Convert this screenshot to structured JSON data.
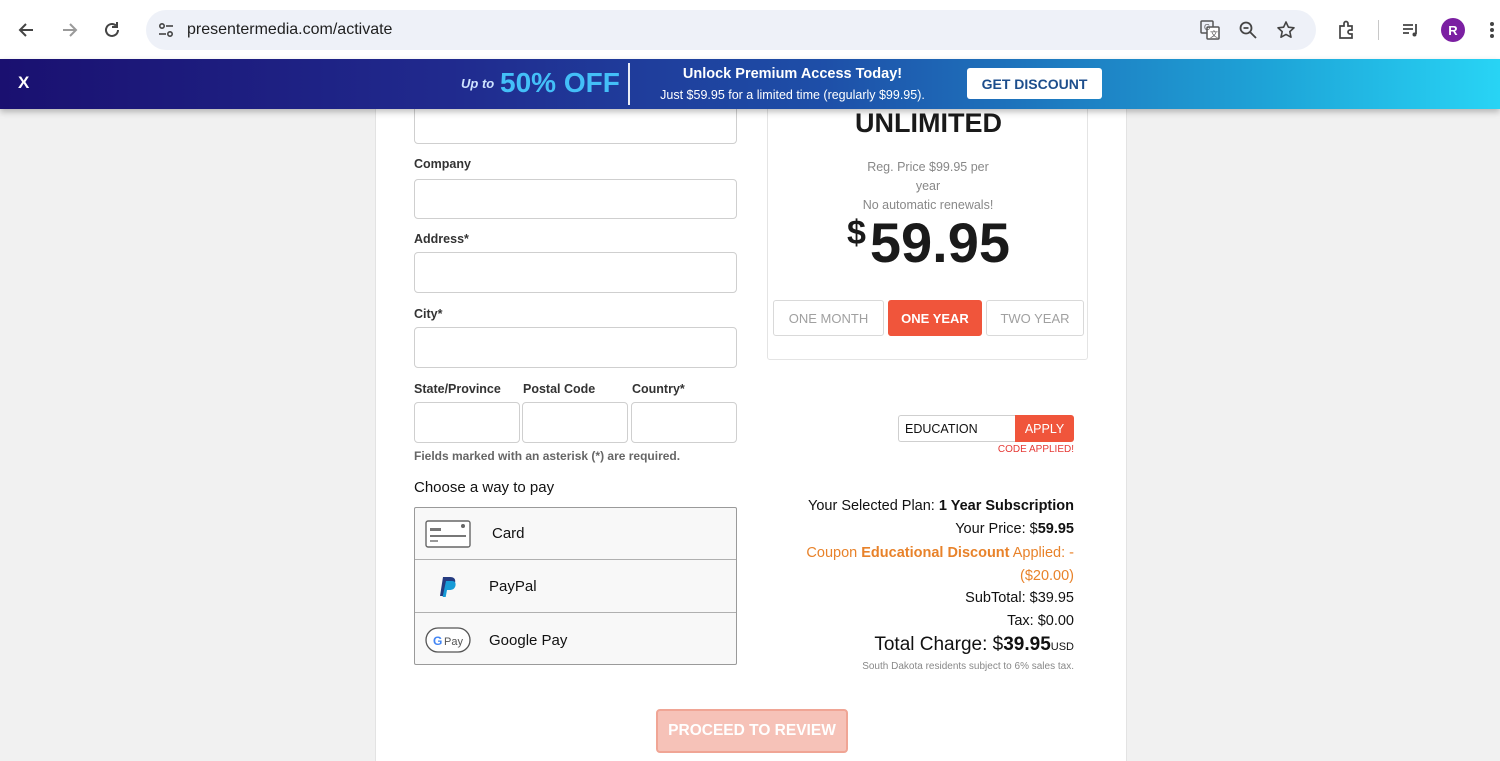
{
  "browser": {
    "url": "presentermedia.com/activate",
    "avatar_letter": "R"
  },
  "promo": {
    "close_label": "X",
    "upto": "Up to",
    "percent": "50% OFF",
    "headline": "Unlock Premium Access Today!",
    "subline": "Just $59.95 for a limited time (regularly $99.95).",
    "cta": "GET DISCOUNT"
  },
  "form": {
    "company_label": "Company",
    "address_label": "Address*",
    "city_label": "City*",
    "state_label": "State/Province",
    "postal_label": "Postal Code",
    "country_label": "Country*",
    "required_note": "Fields marked with an asterisk (*) are required.",
    "pay_title": "Choose a way to pay",
    "pay_methods": [
      {
        "label": "Card"
      },
      {
        "label": "PayPal"
      },
      {
        "label": "Google Pay"
      }
    ]
  },
  "plan": {
    "name": "UNLIMITED",
    "reg_price_line1": "Reg. Price $99.95 per",
    "reg_price_line2": "year",
    "reg_price_line3": "No automatic renewals!",
    "currency": "$",
    "price": "59.95",
    "periods": [
      {
        "label": "ONE MONTH",
        "active": false
      },
      {
        "label": "ONE YEAR",
        "active": true
      },
      {
        "label": "TWO YEAR",
        "active": false
      }
    ]
  },
  "coupon": {
    "value": "EDUCATION",
    "apply_label": "APPLY",
    "status": "CODE APPLIED!"
  },
  "summary": {
    "selected_plan_label": "Your Selected Plan:",
    "selected_plan_value": "1 Year Subscription",
    "your_price_label": "Your Price: $",
    "your_price_value": "59.95",
    "coupon_prefix": "Coupon",
    "coupon_name": "Educational Discount",
    "coupon_suffix": "Applied: -",
    "coupon_amount": "($20.00)",
    "subtotal": "SubTotal: $39.95",
    "tax": "Tax: $0.00",
    "total_label": "Total Charge: $",
    "total_value": "39.95",
    "total_currency": "USD",
    "tax_note": "South Dakota residents subject to 6% sales tax."
  },
  "proceed_label": "PROCEED TO REVIEW",
  "colors": {
    "accent": "#f0553b",
    "coupon_text": "#e8822a",
    "banner_start": "#1a1070",
    "banner_end": "#28d4f5"
  }
}
